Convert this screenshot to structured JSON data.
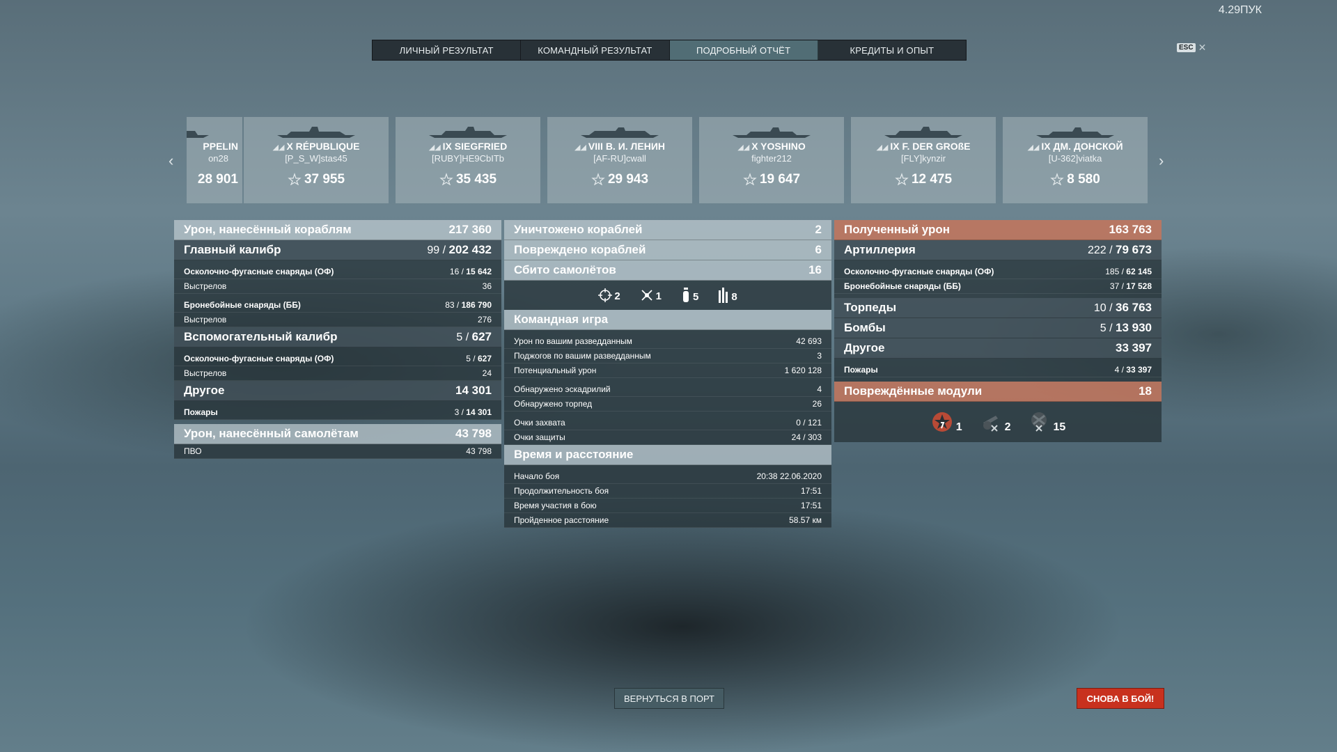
{
  "top_right_text": "4.29ПУК",
  "esc_label": "ESC",
  "tabs": [
    {
      "label": "ЛИЧНЫЙ РЕЗУЛЬТАТ"
    },
    {
      "label": "КОМАНДНЫЙ РЕЗУЛЬТАТ"
    },
    {
      "label": "ПОДРОБНЫЙ ОТЧЁТ",
      "active": true
    },
    {
      "label": "КРЕДИТЫ И ОПЫТ"
    }
  ],
  "ships": [
    {
      "name": "PPELIN",
      "player": "on28",
      "xp": "28 901"
    },
    {
      "name": "X RÉPUBLIQUE",
      "player": "[P_S_W]stas45",
      "xp": "37 955"
    },
    {
      "name": "IX SIEGFRIED",
      "player": "[RUBY]HE9CbITb",
      "xp": "35 435"
    },
    {
      "name": "VIII В. И. ЛЕНИН",
      "player": "[AF-RU]cwall",
      "xp": "29 943"
    },
    {
      "name": "X YOSHINO",
      "player": "fighter212",
      "xp": "19 647"
    },
    {
      "name": "IX F. DER GROßE",
      "player": "[FLY]kynzir",
      "xp": "12 475"
    },
    {
      "name": "IX ДМ. ДОНСКОЙ",
      "player": "[U-362]viatka",
      "xp": "8 580"
    }
  ],
  "left": {
    "damage_ships": {
      "label": "Урон, нанесённый кораблям",
      "value": "217 360"
    },
    "main_caliber": {
      "label": "Главный калибр",
      "hits": "99",
      "value": "202 432"
    },
    "mc_he": {
      "label": "Осколочно-фугасные снаряды (ОФ)",
      "hits": "16",
      "value": "15 642"
    },
    "mc_he_shots": {
      "label": "Выстрелов",
      "value": "36"
    },
    "mc_ap": {
      "label": "Бронебойные снаряды (ББ)",
      "hits": "83",
      "value": "186 790"
    },
    "mc_ap_shots": {
      "label": "Выстрелов",
      "value": "276"
    },
    "secondary": {
      "label": "Вспомогательный калибр",
      "hits": "5",
      "value": "627"
    },
    "sec_he": {
      "label": "Осколочно-фугасные снаряды (ОФ)",
      "hits": "5",
      "value": "627"
    },
    "sec_he_shots": {
      "label": "Выстрелов",
      "value": "24"
    },
    "other": {
      "label": "Другое",
      "value": "14 301"
    },
    "fires": {
      "label": "Пожары",
      "hits": "3",
      "value": "14 301"
    },
    "damage_planes": {
      "label": "Урон, нанесённый самолётам",
      "value": "43 798"
    },
    "aa": {
      "label": "ПВО",
      "value": "43 798"
    }
  },
  "middle": {
    "destroyed": {
      "label": "Уничтожено кораблей",
      "value": "2"
    },
    "damaged": {
      "label": "Повреждено кораблей",
      "value": "6"
    },
    "planes_down": {
      "label": "Сбито самолётов",
      "value": "16"
    },
    "plane_types": [
      {
        "icon": "crosshair-icon",
        "value": "2"
      },
      {
        "icon": "fighter-icon",
        "value": "1"
      },
      {
        "icon": "bomb-icon",
        "value": "5"
      },
      {
        "icon": "torpedo-bomber-icon",
        "value": "8"
      }
    ],
    "team_header": "Командная игра",
    "team": [
      {
        "label": "Урон по вашим разведданным",
        "value": "42 693"
      },
      {
        "label": "Поджогов по вашим разведданным",
        "value": "3"
      },
      {
        "label": "Потенциальный урон",
        "value": "1 620 128"
      },
      {
        "label": "Обнаружено эскадрилий",
        "value": "4"
      },
      {
        "label": "Обнаружено торпед",
        "value": "26"
      },
      {
        "label": "Очки захвата",
        "value": "0 / 121"
      },
      {
        "label": "Очки защиты",
        "value": "24 / 303"
      }
    ],
    "time_header": "Время и расстояние",
    "time": [
      {
        "label": "Начало боя",
        "value": "20:38  22.06.2020"
      },
      {
        "label": "Продолжительность боя",
        "value": "17:51"
      },
      {
        "label": "Время участия в бою",
        "value": "17:51"
      },
      {
        "label": "Пройденное расстояние",
        "value": "58.57 км"
      }
    ]
  },
  "right": {
    "received": {
      "label": "Полученный урон",
      "value": "163 763"
    },
    "artillery": {
      "label": "Артиллерия",
      "hits": "222",
      "value": "79 673"
    },
    "art_he": {
      "label": "Осколочно-фугасные снаряды (ОФ)",
      "hits": "185",
      "value": "62 145"
    },
    "art_ap": {
      "label": "Бронебойные снаряды (ББ)",
      "hits": "37",
      "value": "17 528"
    },
    "torpedoes": {
      "label": "Торпеды",
      "hits": "10",
      "value": "36 763"
    },
    "bombs": {
      "label": "Бомбы",
      "hits": "5",
      "value": "13 930"
    },
    "other": {
      "label": "Другое",
      "value": "33 397"
    },
    "fires": {
      "label": "Пожары",
      "hits": "4",
      "value": "33 397"
    },
    "modules": {
      "label": "Повреждённые модули",
      "value": "18"
    },
    "module_types": [
      {
        "icon": "engine-damage-icon",
        "value": "1"
      },
      {
        "icon": "gun-damage-icon",
        "value": "2"
      },
      {
        "icon": "torpedo-tube-damage-icon",
        "value": "15"
      }
    ]
  },
  "buttons": {
    "port": "ВЕРНУТЬСЯ В ПОРТ",
    "battle": "СНОВА В БОЙ!"
  }
}
